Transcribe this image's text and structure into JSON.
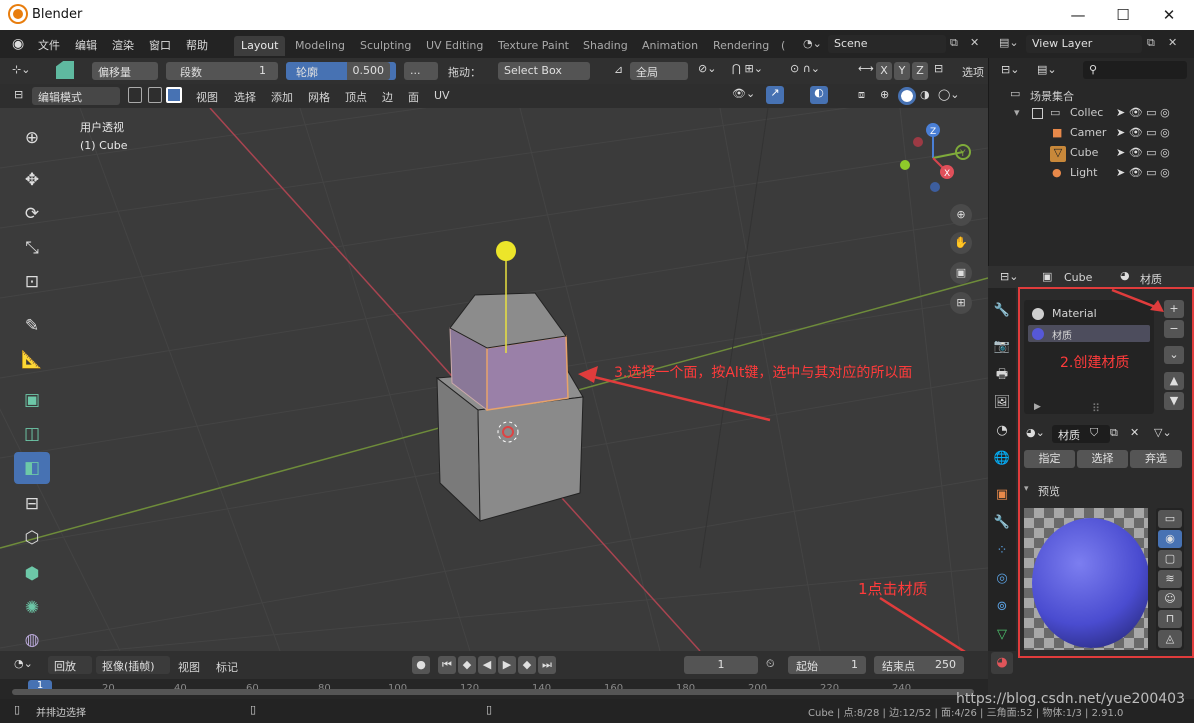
{
  "window": {
    "title": "Blender",
    "min": "—",
    "max": "☐",
    "close": "✕"
  },
  "menu": {
    "items": [
      "文件",
      "编辑",
      "渲染",
      "窗口",
      "帮助"
    ]
  },
  "workspaces": {
    "tabs": [
      "Layout",
      "Modeling",
      "Sculpting",
      "UV Editing",
      "Texture Paint",
      "Shading",
      "Animation",
      "Rendering"
    ],
    "more": "("
  },
  "scene": {
    "label": "Scene",
    "view_layer": "View Layer"
  },
  "tool_header": {
    "offset": "偏移量",
    "segments_label": "段数",
    "segments_value": "1",
    "profile_label": "轮廓",
    "profile_value": "0.500",
    "more": "...",
    "drag": "拖动：",
    "select_box": "Select Box",
    "global": "全局",
    "options": "选项",
    "x": "X",
    "y": "Y",
    "z": "Z"
  },
  "viewport_header": {
    "mode": "编辑模式",
    "menus": [
      "视图",
      "选择",
      "添加",
      "网格",
      "顶点",
      "边",
      "面",
      "UV"
    ]
  },
  "viewport": {
    "view_name": "用户透视",
    "object_name": "(1) Cube",
    "gizmo": {
      "x": "X",
      "y": "Y",
      "z": "Z"
    }
  },
  "annotations": {
    "step1": "1点击材质",
    "step2": "2.创建材质",
    "step3": "3.选择一个面，按Alt键，选中与其对应的所以面"
  },
  "outliner": {
    "root": "场景集合",
    "items": [
      {
        "name": "Collec"
      },
      {
        "name": "Camer"
      },
      {
        "name": "Cube"
      },
      {
        "name": "Light"
      }
    ]
  },
  "properties": {
    "object": "Cube",
    "context": "材质",
    "slots": [
      "Material",
      "材质"
    ],
    "material_name": "材质",
    "assign": "指定",
    "select": "选择",
    "deselect": "弃选",
    "preview": "预览"
  },
  "timeline": {
    "playback": "回放",
    "keying": "抠像(插帧)",
    "view": "视图",
    "marker": "标记",
    "current": "1",
    "start_label": "起始",
    "start": "1",
    "end_label": "结束点",
    "end": "250",
    "ticks": [
      "1",
      "20",
      "40",
      "60",
      "80",
      "100",
      "120",
      "140",
      "160",
      "180",
      "200",
      "220",
      "240"
    ]
  },
  "statusbar": {
    "left": "并排边选择",
    "right": "Cube | 点:8/28 | 边:12/52 | 面:4/26 | 三角面:52 | 物体:1/3 | 2.91.0",
    "watermark": "https://blog.csdn.net/yue200403"
  },
  "colors": {
    "accent": "#4772b3",
    "annotation": "#e03c3c",
    "face_selected": "#9a80a8",
    "sphere": "#5658d8"
  }
}
